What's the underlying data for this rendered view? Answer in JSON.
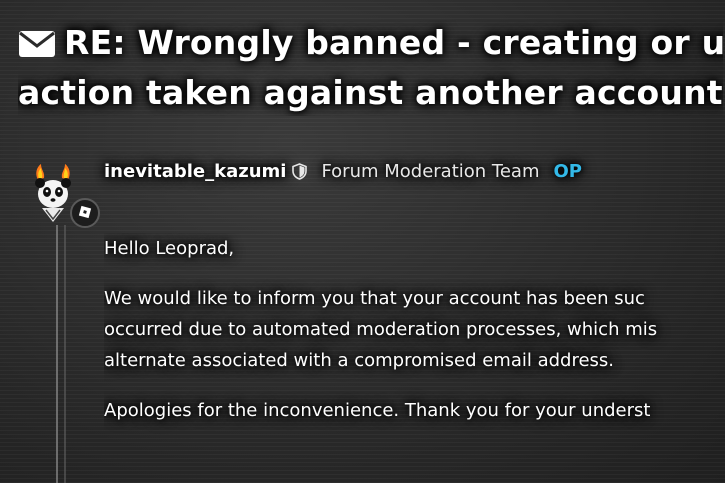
{
  "topic": {
    "title_line1": "RE: Wrongly banned - creating or us",
    "title_line2": "action taken against another account",
    "icon": "envelope-icon"
  },
  "post": {
    "author": {
      "username": "inevitable_kazumi",
      "role_icon": "shield-icon",
      "team": "Forum Moderation Team",
      "op_label": "OP",
      "op_color": "#33b9e8",
      "avatar": "panda-avatar",
      "badge_icon": "roblox-icon"
    },
    "greeting": "Hello Leoprad,",
    "paragraph1": [
      "We would like to inform you that your account has been suc",
      "occurred due to automated moderation processes, which mis",
      "alternate associated with a compromised email address."
    ],
    "paragraph2": "Apologies for the inconvenience. Thank you for your underst"
  }
}
